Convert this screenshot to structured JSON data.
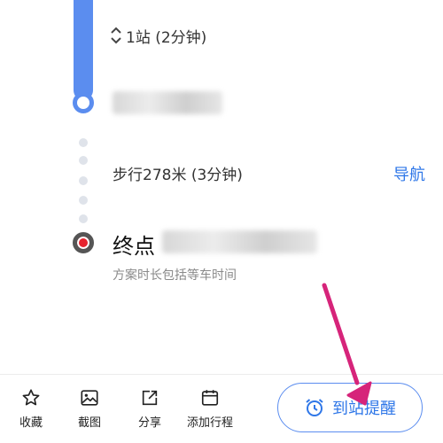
{
  "route": {
    "stops_summary": "1站 (2分钟)",
    "walk_text": "步行278米 (3分钟)",
    "nav_label": "导航",
    "destination_label": "终点",
    "note": "方案时长包括等车时间"
  },
  "toolbar": {
    "favorite_label": "收藏",
    "screenshot_label": "截图",
    "share_label": "分享",
    "add_trip_label": "添加行程",
    "remind_label": "到站提醒"
  },
  "colors": {
    "route_blue": "#5b8def",
    "link_blue": "#2f77e8",
    "destination_red": "#e8232e",
    "arrow_pink": "#d6247a"
  }
}
